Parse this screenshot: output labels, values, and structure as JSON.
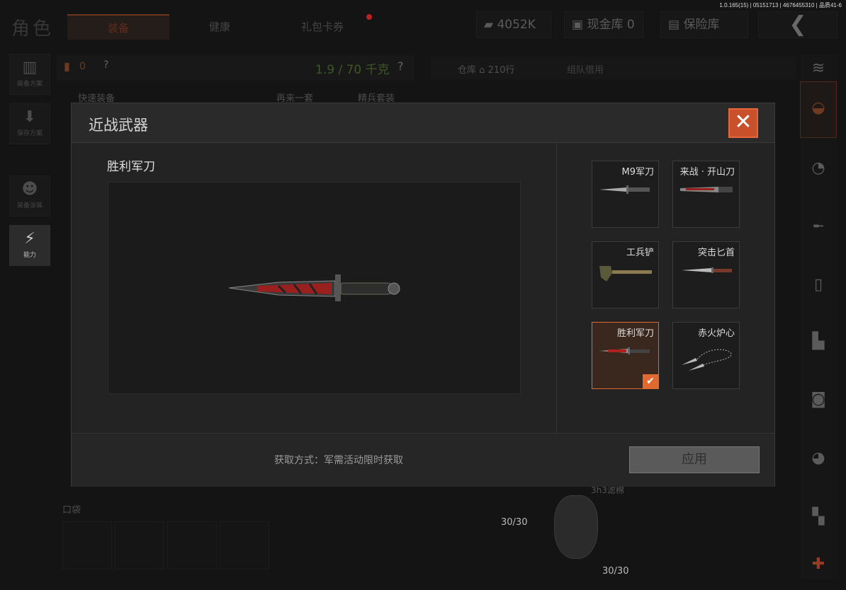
{
  "version_info": "1.0.165(15) | 05151713 | 4676455310 | 品质41-6",
  "page_title": "角色",
  "top_tabs": [
    {
      "label": "装备"
    },
    {
      "label": "健康"
    },
    {
      "label": "礼包卡券"
    }
  ],
  "resources": {
    "money": "4052K",
    "cash_vault": "现金库 0",
    "safe_vault": "保险库"
  },
  "left_side": {
    "buttons": [
      "装备方案",
      "保存方案",
      "装备涂装",
      "能力"
    ],
    "armor_count": "0",
    "weight": "1.9 / 70 千克",
    "help": "?",
    "quick_equip": "快速装备",
    "again": "再来一套",
    "elite": "精兵套装",
    "pockets_label": "口袋"
  },
  "stash": {
    "tab": "仓库",
    "rows": "210行",
    "team_tab": "组队借用",
    "count1": "30/30",
    "count2": "30/30",
    "item_label": "3h3滤棉"
  },
  "modal": {
    "title": "近战武器",
    "close_icon": "close-icon",
    "selected_name": "胜利军刀",
    "weapons": [
      {
        "name": "M9军刀",
        "selected": false
      },
      {
        "name": "来战 · 开山刀",
        "selected": false
      },
      {
        "name": "工兵铲",
        "selected": false
      },
      {
        "name": "突击匕首",
        "selected": false
      },
      {
        "name": "胜利军刀",
        "selected": true
      },
      {
        "name": "赤火炉心",
        "selected": false
      }
    ],
    "source": "获取方式：军需活动限时获取",
    "apply": "应用"
  },
  "colors": {
    "accent": "#e06a30",
    "weight_green": "#6fae3a"
  }
}
